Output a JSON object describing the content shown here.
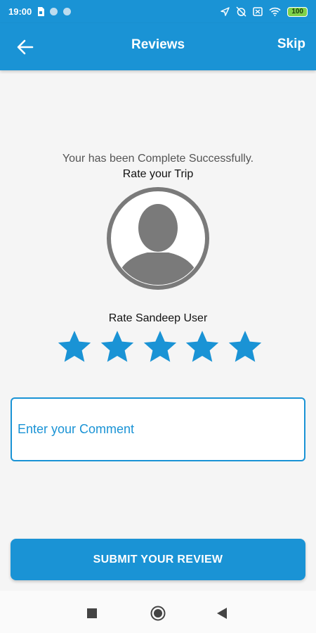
{
  "status_bar": {
    "time": "19:00",
    "battery": "100",
    "icons": [
      "sim-card-icon",
      "notification-dot-icon",
      "notification-dot-icon",
      "location-icon",
      "alarm-off-icon",
      "no-sim-icon",
      "wifi-icon",
      "battery-icon"
    ]
  },
  "app_bar": {
    "back_icon": "arrow-left-icon",
    "title": "Reviews",
    "skip_label": "Skip"
  },
  "main": {
    "success_message": "Your has been Complete Successfully.",
    "rate_trip_label": "Rate your Trip",
    "avatar_icon": "user-avatar-icon",
    "rate_user_label": "Rate Sandeep User",
    "rating": {
      "value": 5,
      "max": 5
    },
    "comment": {
      "value": "",
      "placeholder": "Enter your Comment"
    },
    "submit_label": "SUBMIT YOUR REVIEW"
  },
  "colors": {
    "primary": "#1a93d5",
    "avatar_gray": "#7a7a7a",
    "background": "#f5f5f5"
  },
  "nav_bar": {
    "icons": [
      "recent-apps-icon",
      "home-icon",
      "back-triangle-icon"
    ]
  }
}
